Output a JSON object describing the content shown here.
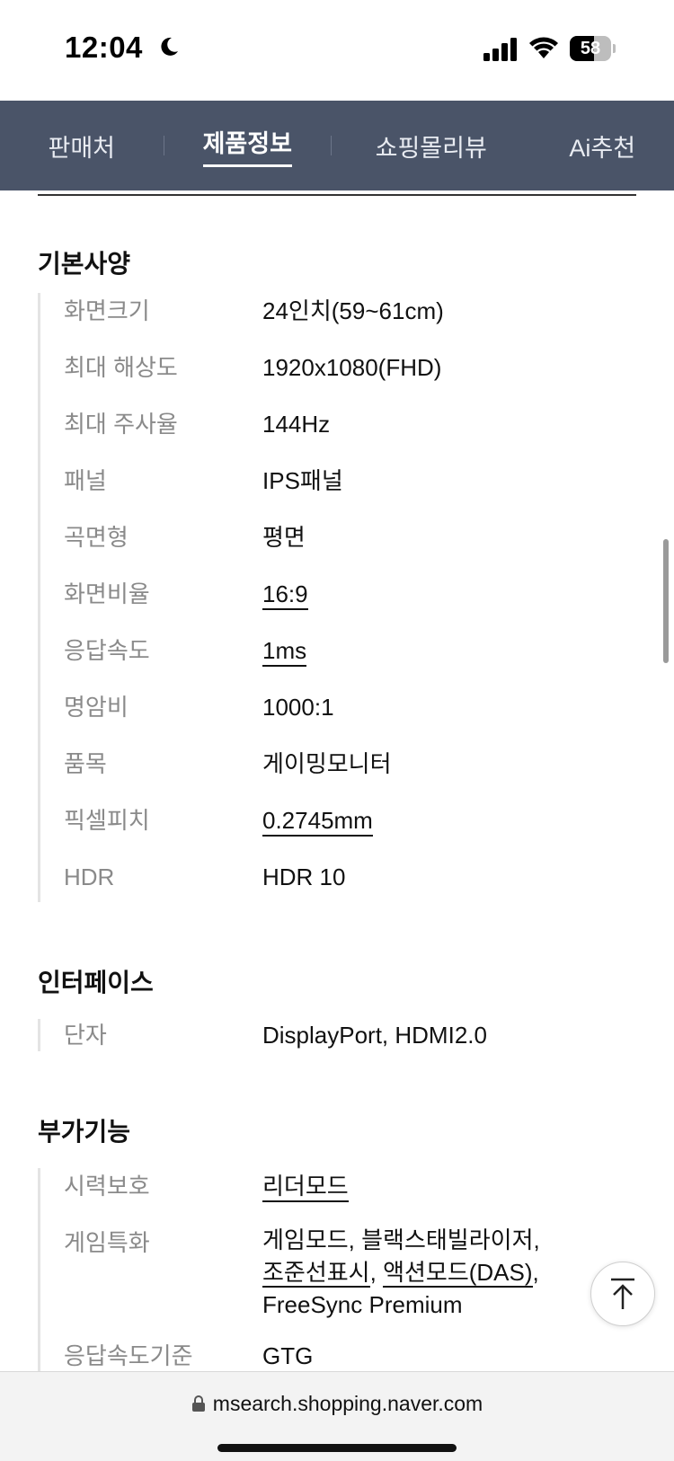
{
  "status_bar": {
    "time": "12:04",
    "battery_level": "58",
    "icons": [
      "moon-icon",
      "signal-icon",
      "wifi-icon",
      "battery-icon"
    ]
  },
  "tabs": [
    {
      "label": "판매처",
      "active": false
    },
    {
      "label": "제품정보",
      "active": true
    },
    {
      "label": "쇼핑몰리뷰",
      "active": false
    },
    {
      "label": "Ai추천",
      "active": false
    }
  ],
  "sections": {
    "basic": {
      "title": "기본사양",
      "rows": [
        {
          "label": "화면크기",
          "value": "24인치(59~61cm)"
        },
        {
          "label": "최대 해상도",
          "value": "1920x1080(FHD)"
        },
        {
          "label": "최대 주사율",
          "value": "144Hz"
        },
        {
          "label": "패널",
          "value": "IPS패널"
        },
        {
          "label": "곡면형",
          "value": "평면"
        },
        {
          "label": "화면비율",
          "value": "16:9"
        },
        {
          "label": "응답속도",
          "value": "1ms"
        },
        {
          "label": "명암비",
          "value": "1000:1"
        },
        {
          "label": "품목",
          "value": "게이밍모니터"
        },
        {
          "label": "픽셀피치",
          "value": "0.2745mm"
        },
        {
          "label": "HDR",
          "value": "HDR 10"
        }
      ]
    },
    "interface": {
      "title": "인터페이스",
      "rows": [
        {
          "label": "단자",
          "value": "DisplayPort, HDMI2.0"
        }
      ]
    },
    "extra": {
      "title": "부가기능",
      "rows": [
        {
          "label": "시력보호",
          "value": "리더모드"
        },
        {
          "label": "게임특화",
          "value_parts": [
            "게임모드, 블랙스태빌라이저,",
            "조준선표시",
            ", ",
            "액션모드(DAS)",
            ", FreeSync Premium"
          ]
        },
        {
          "label": "응답속도기준",
          "value": "GTG"
        }
      ]
    }
  },
  "bottom_bar": {
    "url": "msearch.shopping.naver.com"
  }
}
